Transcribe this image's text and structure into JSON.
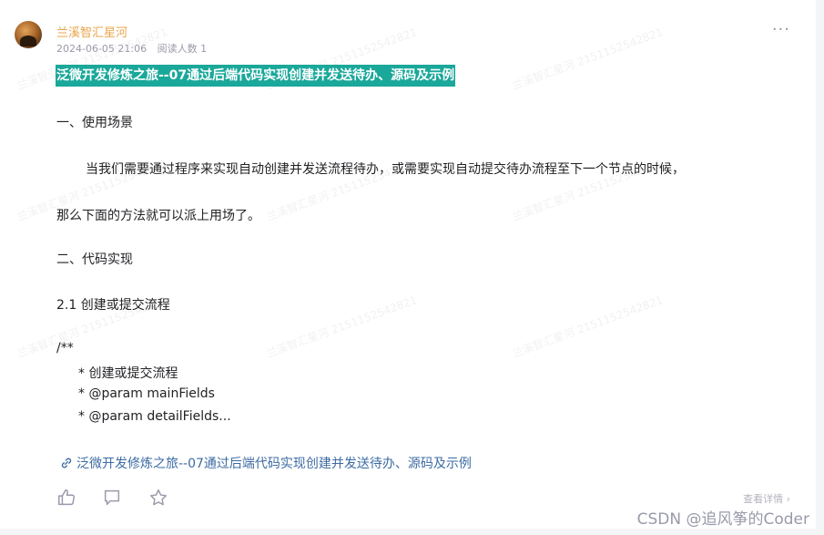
{
  "post": {
    "author": "兰溪智汇星河",
    "date": "2024-06-05 21:06",
    "read_count": "阅读人数 1",
    "more_icon": "more-dots-icon",
    "title": "泛微开发修炼之旅--07通过后端代码实现创建并发送待办、源码及示例",
    "heading1": "一、使用场景",
    "para1": "当我们需要通过程序来实现自动创建并发送流程待办，或需要实现自动提交待办流程至下一个节点的时候，",
    "para2": "那么下面的方法就可以派上用场了。",
    "heading2": "二、代码实现",
    "heading3": "2.1 创建或提交流程",
    "code": [
      "/**",
      "* 创建或提交流程",
      "* @param mainFields",
      "* @param detailFields..."
    ],
    "link_text": "泛微开发修炼之旅--07通过后端代码实现创建并发送待办、源码及示例",
    "link_icon": "link-icon",
    "details_label": "查看详情",
    "actions": [
      {
        "icon": "thumbs-up-icon"
      },
      {
        "icon": "comment-icon"
      },
      {
        "icon": "star-icon"
      }
    ]
  },
  "watermark": "兰溪智汇星河 2151152542821",
  "site_watermark": "CSDN @追风筝的Coder",
  "colors": {
    "author": "#e9a54a",
    "title_highlight": "#1aa89a",
    "link": "#3d6ba3"
  }
}
